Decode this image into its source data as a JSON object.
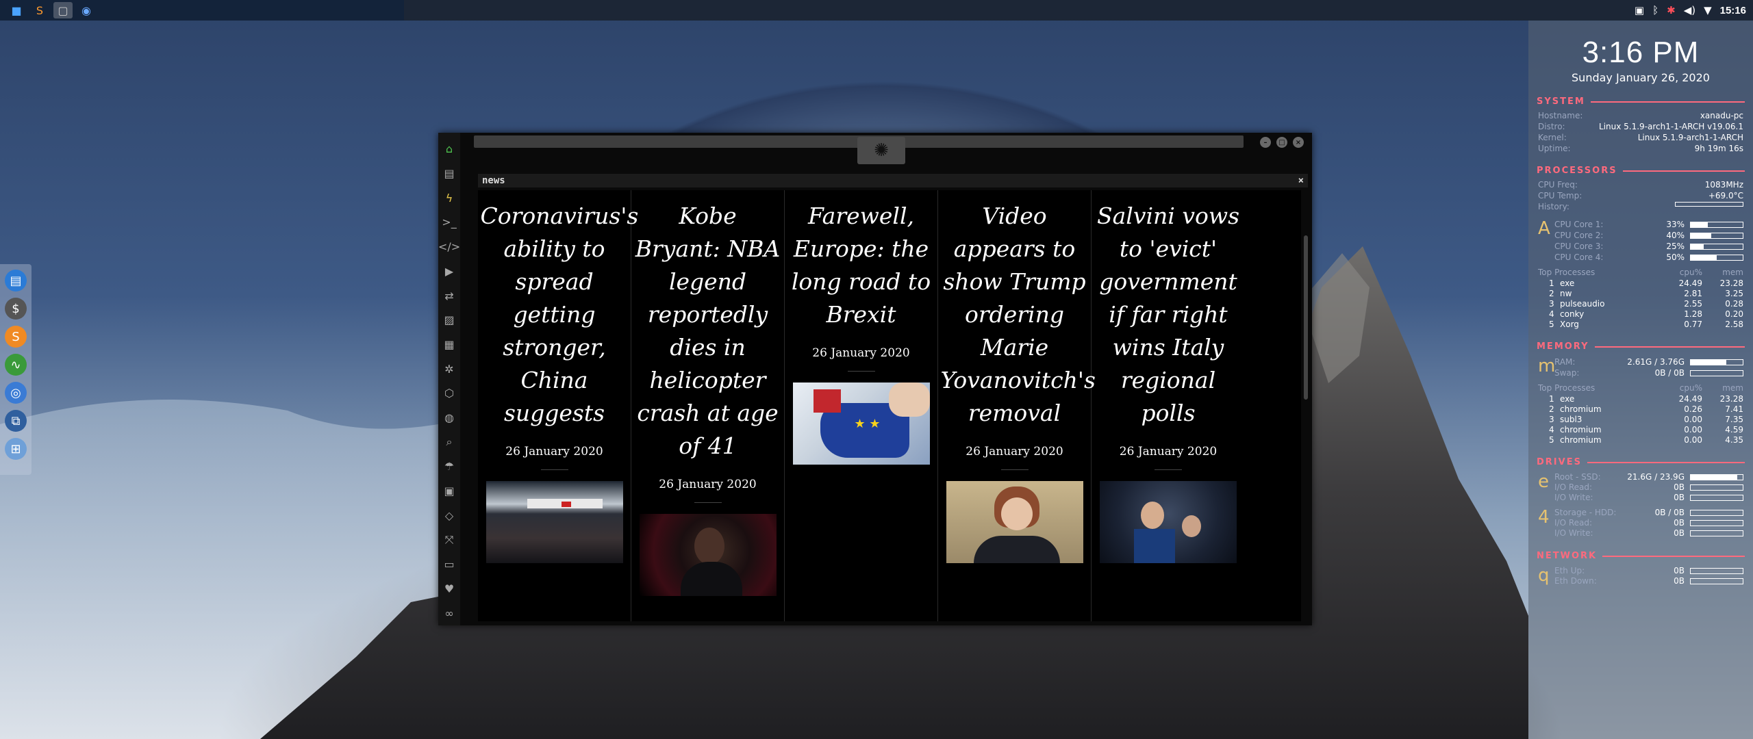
{
  "top_panel": {
    "clock": "15:16",
    "tray_icons": [
      "screen-icon",
      "bluetooth-icon",
      "update-icon",
      "volume-icon",
      "wifi-icon"
    ]
  },
  "window": {
    "pane_title": "news",
    "pane_close": "×",
    "articles": [
      {
        "headline": "Coronavirus's ability to spread getting stronger, China suggests",
        "date": "26 January 2020",
        "image": "crowd-photo"
      },
      {
        "headline": "Kobe Bryant: NBA legend reportedly dies in helicopter crash at age of 41",
        "date": "26 January 2020",
        "image": "kobe-photo"
      },
      {
        "headline": "Farewell, Europe: the long road to Brexit",
        "date": "26 January 2020",
        "image": "eu-map-photo"
      },
      {
        "headline": "Video appears to show Trump ordering Marie Yovanovitch's removal",
        "date": "26 January 2020",
        "image": "yovanovitch-photo"
      },
      {
        "headline": "Salvini vows to 'evict' government if far right wins Italy regional polls",
        "date": "26 January 2020",
        "image": "salvini-photo"
      }
    ]
  },
  "conky": {
    "time": "3:16 PM",
    "date": "Sunday January 26, 2020",
    "system": {
      "title": "SYSTEM",
      "rows": [
        {
          "k": "Hostname:",
          "v": "xanadu-pc"
        },
        {
          "k": "Distro:",
          "v": "Linux 5.1.9-arch1-1-ARCH v19.06.1"
        },
        {
          "k": "Kernel:",
          "v": "Linux 5.1.9-arch1-1-ARCH"
        },
        {
          "k": "Uptime:",
          "v": "9h 19m 16s"
        }
      ]
    },
    "processors": {
      "title": "PROCESSORS",
      "freq_k": "CPU Freq:",
      "freq_v": "1083MHz",
      "temp_k": "CPU Temp:",
      "temp_v": "+69.0°C",
      "hist_k": "History:",
      "letter": "A",
      "cores": [
        {
          "k": "CPU Core 1:",
          "v": "33%",
          "pct": 33
        },
        {
          "k": "CPU Core 2:",
          "v": "40%",
          "pct": 40
        },
        {
          "k": "CPU Core 3:",
          "v": "25%",
          "pct": 25
        },
        {
          "k": "CPU Core 4:",
          "v": "50%",
          "pct": 50
        }
      ],
      "top_title": "Top Processes",
      "col_cpu": "cpu%",
      "col_mem": "mem",
      "procs": [
        {
          "n": "1",
          "name": "exe",
          "c": "24.49",
          "m": "23.28"
        },
        {
          "n": "2",
          "name": "nw",
          "c": "2.81",
          "m": "3.25"
        },
        {
          "n": "3",
          "name": "pulseaudio",
          "c": "2.55",
          "m": "0.28"
        },
        {
          "n": "4",
          "name": "conky",
          "c": "1.28",
          "m": "0.20"
        },
        {
          "n": "5",
          "name": "Xorg",
          "c": "0.77",
          "m": "2.58"
        }
      ]
    },
    "memory": {
      "title": "MEMORY",
      "letter": "m",
      "ram_k": "RAM:",
      "ram_v": "2.61G / 3.76G",
      "ram_pct": 69,
      "swap_k": "Swap:",
      "swap_v": "0B / 0B",
      "top_title": "Top Processes",
      "col_cpu": "cpu%",
      "col_mem": "mem",
      "procs": [
        {
          "n": "1",
          "name": "exe",
          "c": "24.49",
          "m": "23.28"
        },
        {
          "n": "2",
          "name": "chromium",
          "c": "0.26",
          "m": "7.41"
        },
        {
          "n": "3",
          "name": "subl3",
          "c": "0.00",
          "m": "7.35"
        },
        {
          "n": "4",
          "name": "chromium",
          "c": "0.00",
          "m": "4.59"
        },
        {
          "n": "5",
          "name": "chromium",
          "c": "0.00",
          "m": "4.35"
        }
      ]
    },
    "drives": {
      "title": "DRIVES",
      "d1_letter": "e",
      "d1_k": "Root - SSD:",
      "d1_v": "21.6G / 23.9G",
      "d1_pct": 90,
      "d1_read_k": "I/O Read:",
      "d1_read_v": "0B",
      "d1_write_k": "I/O Write:",
      "d1_write_v": "0B",
      "d2_letter": "4",
      "d2_k": "Storage - HDD:",
      "d2_v": "0B / 0B",
      "d2_pct": 0,
      "d2_read_k": "I/O Read:",
      "d2_read_v": "0B",
      "d2_write_k": "I/O Write:",
      "d2_write_v": "0B"
    },
    "network": {
      "title": "NETWORK",
      "letter": "q",
      "up_k": "Eth Up:",
      "up_v": "0B",
      "down_k": "Eth Down:",
      "down_v": "0B"
    }
  }
}
